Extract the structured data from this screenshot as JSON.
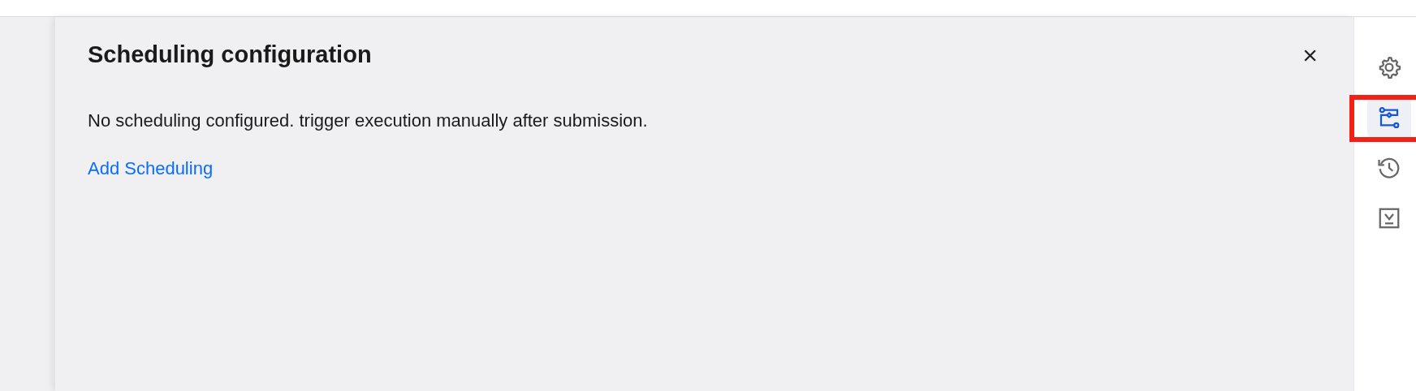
{
  "panel": {
    "title": "Scheduling configuration",
    "close_label": "×",
    "message": "No scheduling configured. trigger execution manually after submission.",
    "link": "Add Scheduling"
  },
  "rail": {
    "items": [
      {
        "kind": "settings",
        "selected": false
      },
      {
        "kind": "flow",
        "selected": true,
        "highlighted": true
      },
      {
        "kind": "history",
        "selected": false
      },
      {
        "kind": "download",
        "selected": false
      }
    ]
  }
}
